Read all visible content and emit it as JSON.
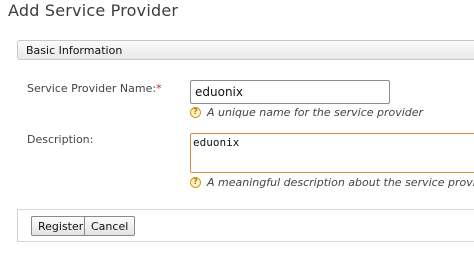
{
  "page": {
    "title": "Add Service Provider"
  },
  "section": {
    "title": "Basic Information"
  },
  "form": {
    "name": {
      "label": "Service Provider Name:",
      "required_mark": "*",
      "value": "eduonix",
      "hint": "A unique name for the service provider",
      "hint_icon": "help-icon"
    },
    "description": {
      "label": "Description:",
      "value": "eduonix",
      "hint": "A meaningful description about the service provider",
      "hint_icon": "help-icon"
    }
  },
  "buttons": {
    "register_label": "Register",
    "cancel_label": "Cancel"
  },
  "colors": {
    "focus_border": "#e48a3e",
    "required": "#dd2222",
    "help_icon": "#d19a1e"
  }
}
